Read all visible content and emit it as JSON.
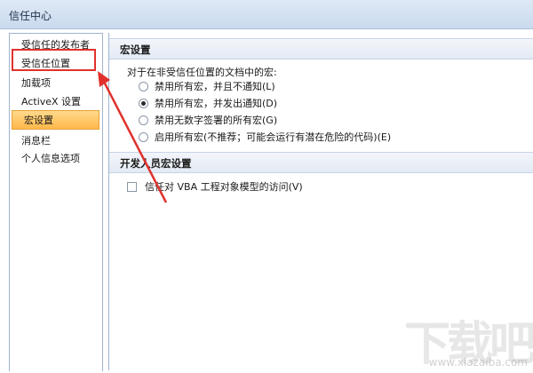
{
  "window": {
    "title": "信任中心",
    "behind_title": "~ ~ ~ ~"
  },
  "sidebar": {
    "items": [
      {
        "label": "受信任的发布者"
      },
      {
        "label": "受信任位置"
      },
      {
        "label": "加载项"
      },
      {
        "label": "ActiveX 设置"
      },
      {
        "label": "宏设置"
      },
      {
        "label": "消息栏"
      },
      {
        "label": "个人信息选项"
      }
    ],
    "active_index": 4,
    "highlighted_index": 1
  },
  "macro_settings": {
    "header": "宏设置",
    "prompt": "对于在非受信任位置的文档中的宏:",
    "options": [
      {
        "label": "禁用所有宏，并且不通知(L)",
        "selected": false
      },
      {
        "label": "禁用所有宏，并发出通知(D)",
        "selected": true
      },
      {
        "label": "禁用无数字签署的所有宏(G)",
        "selected": false
      },
      {
        "label": "启用所有宏(不推荐；可能会运行有潜在危险的代码)(E)",
        "selected": false
      }
    ]
  },
  "developer_settings": {
    "header": "开发人员宏设置",
    "checkbox_label": "信任对 VBA 工程对象模型的访问(V)",
    "checked": false
  },
  "annotation": {
    "color": "#e0312c"
  },
  "watermark": {
    "text": "下载吧",
    "url": "www.xiazaiba.com"
  }
}
